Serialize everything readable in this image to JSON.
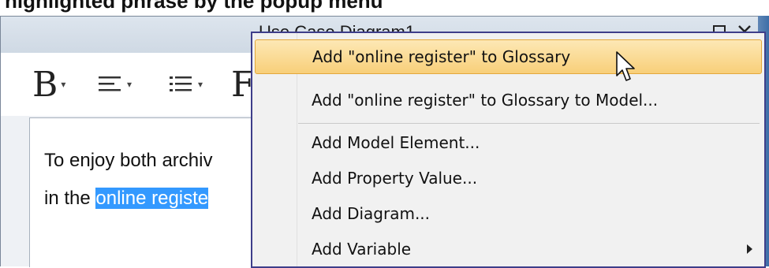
{
  "background_header": {
    "partial_text": "highlighted phrase by the popup menu"
  },
  "window": {
    "title": "Use Case Diagram1"
  },
  "toolbar": {
    "bold_glyph": "B",
    "font_glyph": "F"
  },
  "editor": {
    "line1": "To enjoy both archiv",
    "line2_prefix": "in the ",
    "line2_selected": "online registe"
  },
  "context_menu": {
    "items": [
      {
        "label": "Add \"online register\" to Glossary",
        "highlighted": true
      },
      {
        "label": "Add \"online register\" to Glossary to Model..."
      },
      {
        "label": "Add Model Element..."
      },
      {
        "label": "Add Property Value..."
      },
      {
        "label": "Add Diagram..."
      },
      {
        "label": "Add Variable",
        "has_submenu": true
      }
    ]
  },
  "colors": {
    "selection": "#3399ff",
    "menu_hover": "#f8cf79",
    "menu_border": "#3e3e8a"
  }
}
